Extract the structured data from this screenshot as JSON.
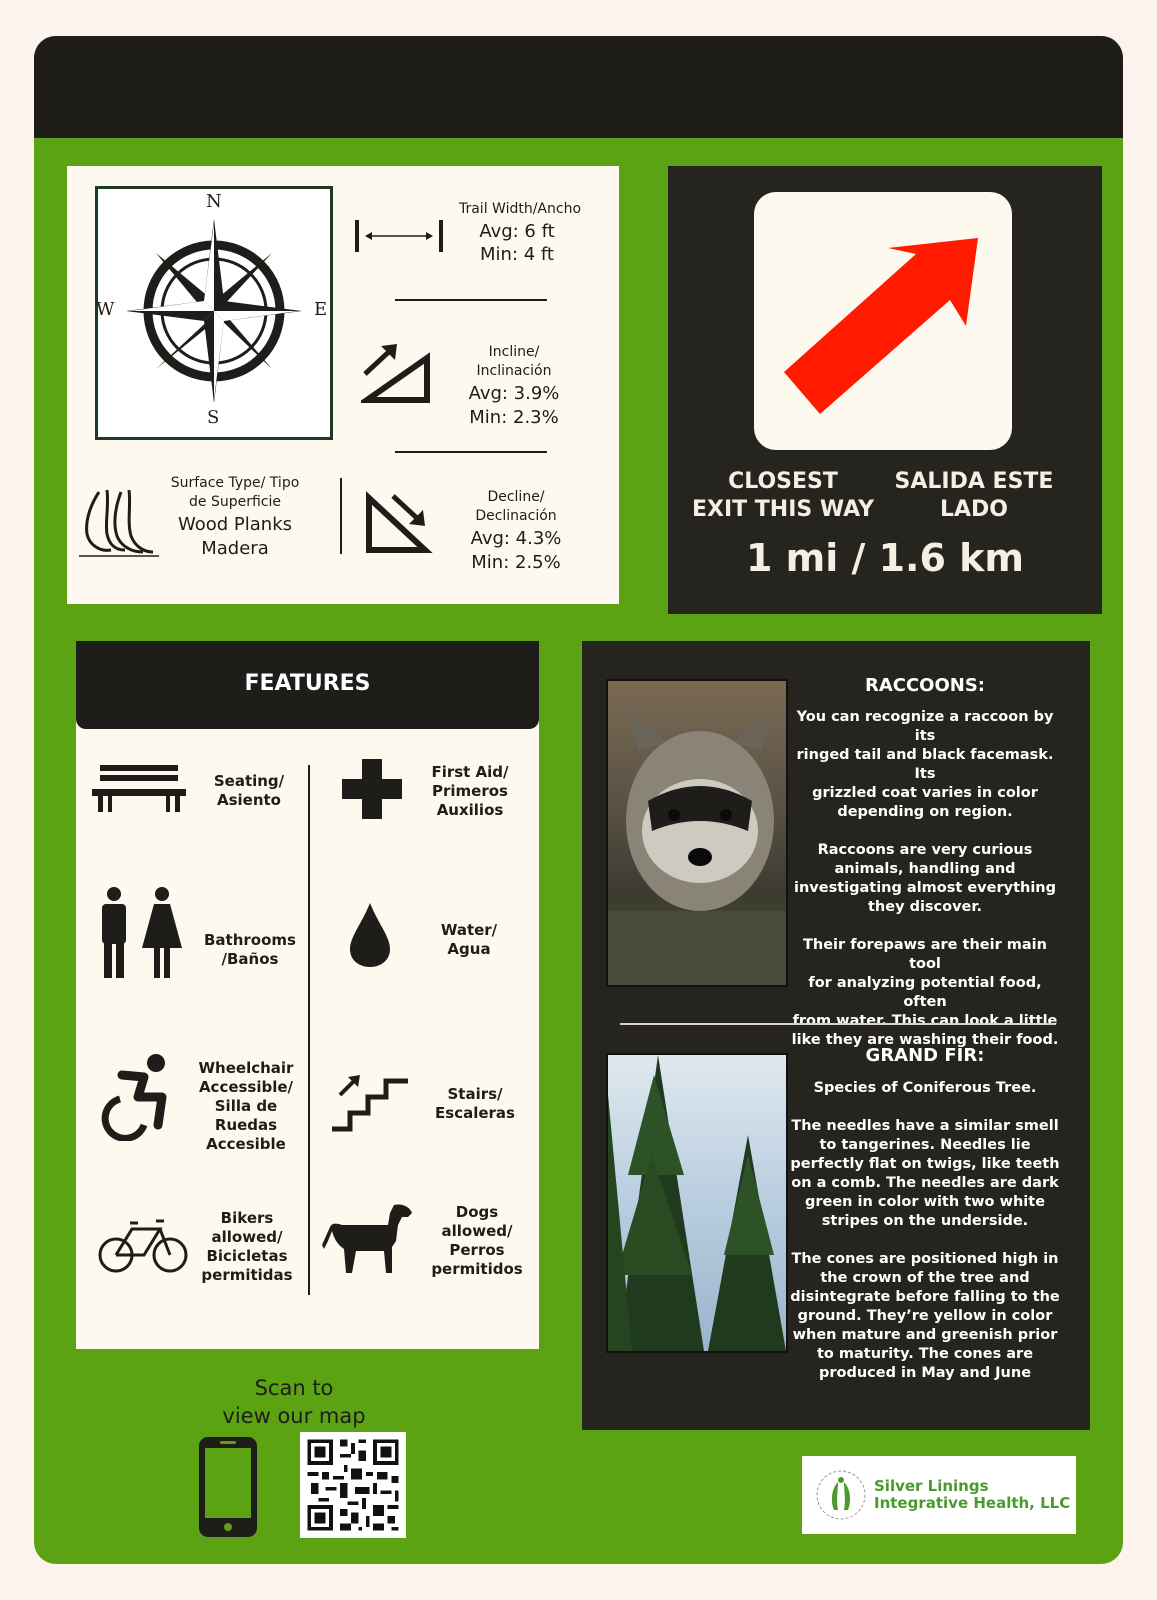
{
  "compass": {
    "n": "N",
    "s": "S",
    "e": "E",
    "w": "W"
  },
  "trail": {
    "width_title": "Trail Width/Ancho",
    "width_avg": "Avg: 6 ft",
    "width_min": "Min: 4 ft",
    "incline_title_1": "Incline/",
    "incline_title_2": "Inclinación",
    "incline_avg": "Avg: 3.9%",
    "incline_min": "Min: 2.3%",
    "decline_title_1": "Decline/",
    "decline_title_2": "Declinación",
    "decline_avg": "Avg: 4.3%",
    "decline_min": "Min: 2.5%",
    "surface_title_1": "Surface Type/ Tipo",
    "surface_title_2": "de Superficie",
    "surface_value_1": "Wood Planks",
    "surface_value_2": "Madera"
  },
  "exit": {
    "label_en_1": "CLOSEST",
    "label_en_2": "EXIT THIS WAY",
    "label_es_1": "SALIDA ESTE",
    "label_es_2": "LADO",
    "distance": "1 mi / 1.6 km",
    "arrow_color": "#ff1a00"
  },
  "features": {
    "title": "FEATURES",
    "items": [
      {
        "icon": "bench-icon",
        "l1": "Seating/",
        "l2": "Asiento"
      },
      {
        "icon": "first-aid-icon",
        "l1": "First Aid/",
        "l2": "Primeros",
        "l3": "Auxilios"
      },
      {
        "icon": "restroom-icon",
        "l1": "Bathrooms",
        "l2": "/Baños"
      },
      {
        "icon": "water-drop-icon",
        "l1": "Water/",
        "l2": "Agua"
      },
      {
        "icon": "wheelchair-icon",
        "l1": "Wheelchair",
        "l2": "Accessible/",
        "l3": "Silla de Ruedas",
        "l4": "Accesible"
      },
      {
        "icon": "stairs-icon",
        "l1": "Stairs/",
        "l2": "Escaleras"
      },
      {
        "icon": "bicycle-icon",
        "l1": "Bikers",
        "l2": "allowed/",
        "l3": "Bicicletas",
        "l4": "permitidas"
      },
      {
        "icon": "dog-icon",
        "l1": "Dogs",
        "l2": "allowed/",
        "l3": "Perros",
        "l4": "permitidos"
      }
    ]
  },
  "raccoon": {
    "title": "RACCOONS:",
    "body": "You can recognize a raccoon by its\nringed tail and black facemask. Its\ngrizzled coat varies in color\ndepending on region.\n\nRaccoons are very curious\nanimals, handling and\ninvestigating almost everything\nthey discover.\n\nTheir forepaws are their main tool\nfor analyzing potential food, often\nfrom water. This  can look a little\nlike they are washing their food."
  },
  "fir": {
    "title": "GRAND FIR:",
    "body": "Species of Coniferous Tree.\n\nThe needles have a similar smell\nto tangerines. Needles lie\nperfectly flat on twigs, like teeth\non a comb. The needles are dark\ngreen in color with two white\nstripes on the underside.\n\nThe cones are positioned high in\nthe crown of the tree and\ndisintegrate before falling to the\nground. They’re yellow in color\nwhen mature and greenish prior\nto maturity.  The cones are\nproduced in May and June"
  },
  "scan": {
    "line1": "Scan to",
    "line2": "view our map"
  },
  "logo": {
    "line1": "Silver Linings",
    "line2": "Integrative Health, LLC"
  },
  "colors": {
    "board_green": "#5ca314",
    "dark": "#1e1d19",
    "cream": "#fdf9ef"
  }
}
